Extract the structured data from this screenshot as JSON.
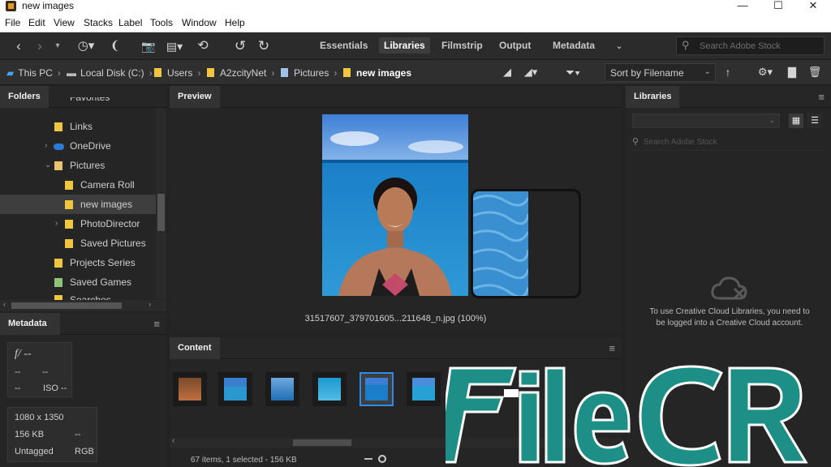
{
  "window": {
    "title": "new images",
    "minimize": "—",
    "maximize": "☐",
    "close": "✕"
  },
  "menu": [
    "File",
    "Edit",
    "View",
    "Stacks",
    "Label",
    "Tools",
    "Window",
    "Help"
  ],
  "toolbar": {
    "workspaces": [
      "Essentials",
      "Libraries",
      "Filmstrip",
      "Output",
      "Metadata"
    ],
    "active_workspace": "Libraries",
    "search_placeholder": "Search Adobe Stock"
  },
  "path": {
    "crumbs": [
      "This PC",
      "Local Disk (C:)",
      "Users",
      "A2zcityNet",
      "Pictures",
      "new images"
    ],
    "sort_label": "Sort by Filename"
  },
  "folders": {
    "title": "Folders",
    "items": [
      {
        "label": "Favorites"
      },
      {
        "label": "Links"
      },
      {
        "label": "OneDrive"
      },
      {
        "label": "Pictures"
      },
      {
        "label": "Camera Roll"
      },
      {
        "label": "new images"
      },
      {
        "label": "PhotoDirector"
      },
      {
        "label": "Saved Pictures"
      },
      {
        "label": "Projects Series"
      },
      {
        "label": "Saved Games"
      },
      {
        "label": "Searches"
      }
    ]
  },
  "metadata": {
    "title": "Metadata",
    "fstop": "f/ --",
    "dash": "--",
    "iso": "ISO --",
    "dimensions": "1080 x 1350",
    "size": "156 KB",
    "label": "Untagged",
    "colorspace": "RGB"
  },
  "preview": {
    "title": "Preview",
    "filename": "31517607_379701605...211648_n.jpg (100%)"
  },
  "content": {
    "title": "Content",
    "status": "67 items, 1 selected - 156 KB"
  },
  "libraries": {
    "title": "Libraries",
    "search_placeholder": "Search Adobe Stock",
    "message": "To use Creative Cloud Libraries, you need to be logged into a Creative Cloud account."
  },
  "watermark": {
    "text": "FileCR"
  },
  "colors": {
    "accent": "#2d8ceb",
    "folder": "#f0c640",
    "watermark": "#1e8f86"
  }
}
